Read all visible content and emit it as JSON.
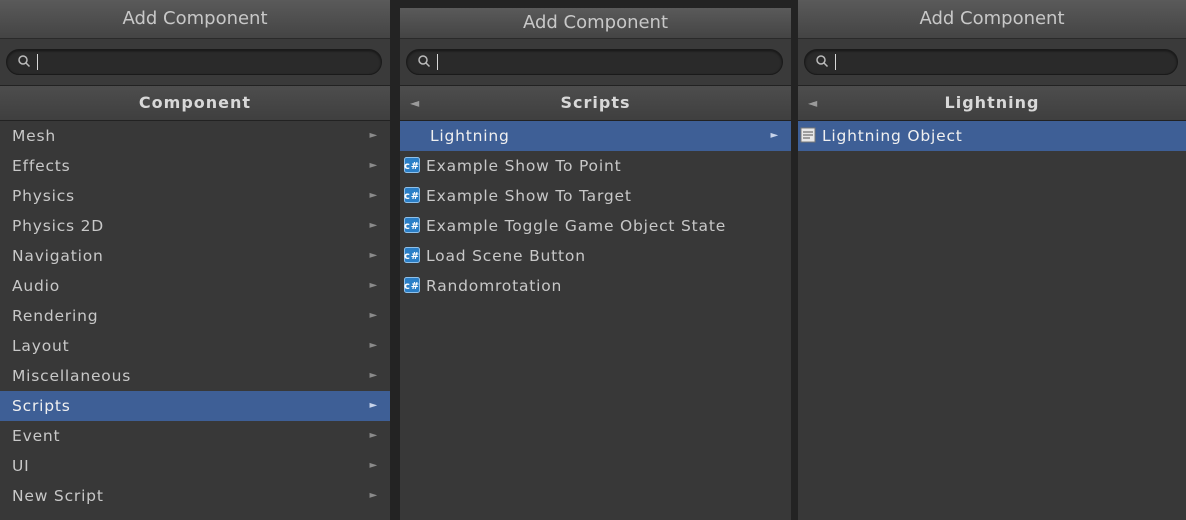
{
  "panels": [
    {
      "title": "Add Component",
      "header": "Component",
      "items": [
        {
          "label": "Mesh"
        },
        {
          "label": "Effects"
        },
        {
          "label": "Physics"
        },
        {
          "label": "Physics 2D"
        },
        {
          "label": "Navigation"
        },
        {
          "label": "Audio"
        },
        {
          "label": "Rendering"
        },
        {
          "label": "Layout"
        },
        {
          "label": "Miscellaneous"
        },
        {
          "label": "Scripts",
          "selected": true
        },
        {
          "label": "Event"
        },
        {
          "label": "UI"
        },
        {
          "label": "New Script"
        }
      ]
    },
    {
      "title": "Add Component",
      "header": "Scripts",
      "items": [
        {
          "label": "Lightning",
          "selected": true
        },
        {
          "label": "Example Show To Point"
        },
        {
          "label": "Example Show To Target"
        },
        {
          "label": "Example Toggle Game Object State"
        },
        {
          "label": "Load Scene Button"
        },
        {
          "label": "Randomrotation"
        }
      ]
    },
    {
      "title": "Add Component",
      "header": "Lightning",
      "items": [
        {
          "label": "Lightning Object",
          "selected": true
        }
      ]
    }
  ],
  "icons": {
    "search": "search-icon",
    "submenu": "arrow-right-icon",
    "back": "arrow-left-icon",
    "script": "csharp-script-icon",
    "component": "document-icon"
  },
  "colors": {
    "selection": "#3e5f96",
    "background": "#383838",
    "text": "#c8c8c8"
  }
}
